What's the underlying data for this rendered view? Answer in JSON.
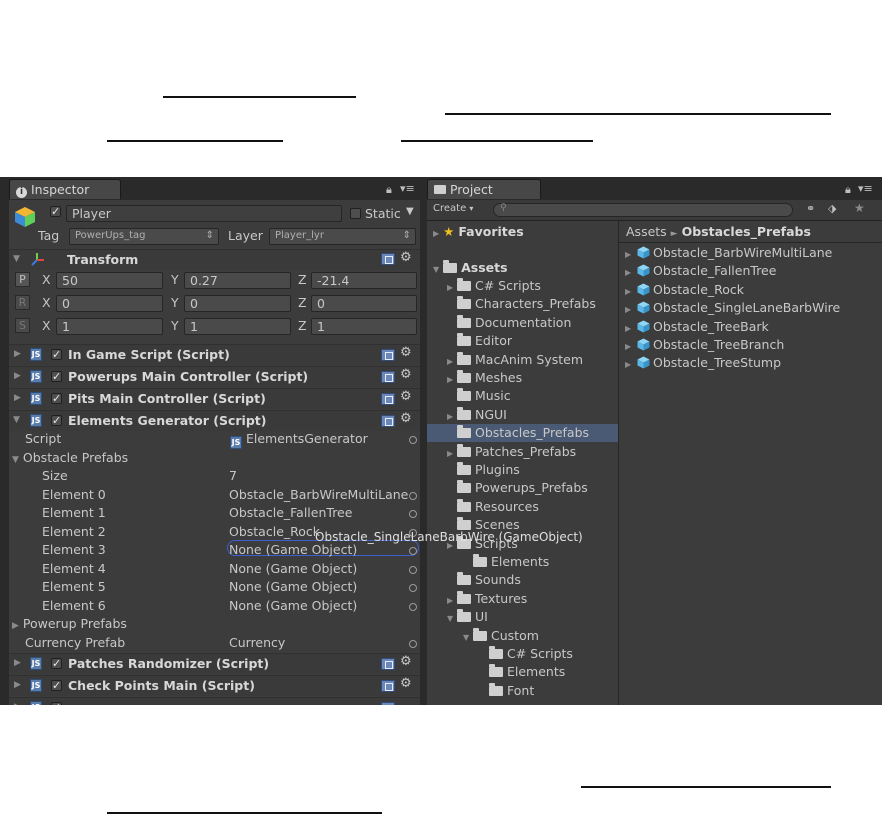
{
  "inspector": {
    "tab_title": "Inspector",
    "object_name": "Player",
    "static_label": "Static",
    "tag_label": "Tag",
    "tag_value": "PowerUps_tag",
    "layer_label": "Layer",
    "layer_value": "Player_lyr",
    "transform": {
      "title": "Transform",
      "position": {
        "btn": "P",
        "x": "50",
        "y": "0.27",
        "z": "-21.4"
      },
      "rotation": {
        "btn": "R",
        "x": "0",
        "y": "0",
        "z": "0"
      },
      "scale": {
        "btn": "S",
        "x": "1",
        "y": "1",
        "z": "1"
      },
      "x_label": "X",
      "y_label": "Y",
      "z_label": "Z"
    },
    "components": [
      {
        "name": "In Game Script (Script)"
      },
      {
        "name": "Powerups Main Controller (Script)"
      },
      {
        "name": "Pits Main Controller (Script)"
      },
      {
        "name": "Elements Generator (Script)"
      }
    ],
    "elements_generator": {
      "script_label": "Script",
      "script_value": "ElementsGenerator",
      "obstacle_prefabs_label": "Obstacle Prefabs",
      "size_label": "Size",
      "size_value": "7",
      "elements": [
        {
          "label": "Element 0",
          "value": "Obstacle_BarbWireMultiLane"
        },
        {
          "label": "Element 1",
          "value": "Obstacle_FallenTree"
        },
        {
          "label": "Element 2",
          "value": "Obstacle_Rock"
        },
        {
          "label": "Element 3",
          "value": "None (Game Object)"
        },
        {
          "label": "Element 4",
          "value": "None (Game Object)"
        },
        {
          "label": "Element 5",
          "value": "None (Game Object)"
        },
        {
          "label": "Element 6",
          "value": "None (Game Object)"
        }
      ],
      "drag_tooltip": "Obstacle_SingleLaneBarbWire (GameObject)",
      "powerup_prefabs_label": "Powerup Prefabs",
      "currency_prefab_label": "Currency Prefab",
      "currency_prefab_value": "Currency"
    },
    "components_after": [
      {
        "name": "Patches Randomizer (Script)"
      },
      {
        "name": "Check Points Main (Script)"
      }
    ]
  },
  "project": {
    "tab_title": "Project",
    "create_label": "Create",
    "favorites_label": "Favorites",
    "assets_label": "Assets",
    "tree": [
      {
        "name": "C# Scripts",
        "arrow": true
      },
      {
        "name": "Characters_Prefabs",
        "arrow": false
      },
      {
        "name": "Documentation",
        "arrow": false
      },
      {
        "name": "Editor",
        "arrow": false
      },
      {
        "name": "MacAnim System",
        "arrow": true
      },
      {
        "name": "Meshes",
        "arrow": true
      },
      {
        "name": "Music",
        "arrow": false
      },
      {
        "name": "NGUI",
        "arrow": true
      },
      {
        "name": "Obstacles_Prefabs",
        "arrow": false,
        "selected": true
      },
      {
        "name": "Patches_Prefabs",
        "arrow": true
      },
      {
        "name": "Plugins",
        "arrow": false
      },
      {
        "name": "Powerups_Prefabs",
        "arrow": false
      },
      {
        "name": "Resources",
        "arrow": false
      },
      {
        "name": "Scenes",
        "arrow": false
      },
      {
        "name": "Scripts",
        "arrow": true
      },
      {
        "name": "Elements",
        "arrow": false,
        "indent": 1
      },
      {
        "name": "Sounds",
        "arrow": false
      },
      {
        "name": "Textures",
        "arrow": true
      },
      {
        "name": "UI",
        "arrow": true,
        "expanded": true
      },
      {
        "name": "Custom",
        "arrow": true,
        "expanded": true,
        "indent": 1
      },
      {
        "name": "C# Scripts",
        "arrow": false,
        "indent": 2
      },
      {
        "name": "Elements",
        "arrow": false,
        "indent": 2
      },
      {
        "name": "Font",
        "arrow": false,
        "indent": 2
      }
    ],
    "breadcrumb_root": "Assets",
    "breadcrumb_sep": "►",
    "breadcrumb_current": "Obstacles_Prefabs",
    "prefabs": [
      "Obstacle_BarbWireMultiLane",
      "Obstacle_FallenTree",
      "Obstacle_Rock",
      "Obstacle_SingleLaneBarbWire",
      "Obstacle_TreeBark",
      "Obstacle_TreeBranch",
      "Obstacle_TreeStump"
    ]
  },
  "colors": {
    "selection": "#4a5a74",
    "highlight_outline": "#3d5fcf",
    "favorite_star": "#f0c020",
    "prefab_cube": "#5ab7e6"
  }
}
